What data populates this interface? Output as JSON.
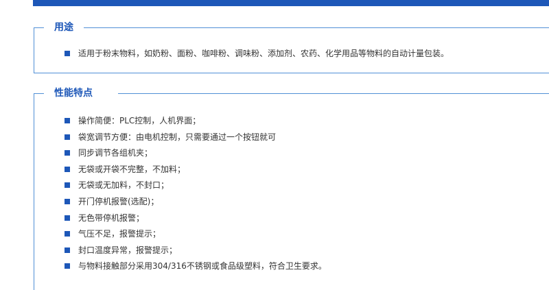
{
  "colors": {
    "accent": "#1d57b8",
    "border": "#4f8fd6",
    "text": "#333333"
  },
  "sections": [
    {
      "title": "用途",
      "items": [
        "适用于粉末物料，如奶粉、面粉、咖啡粉、调味粉、添加剂、农药、化学用品等物料的自动计量包装。"
      ]
    },
    {
      "title": "性能特点",
      "items": [
        "操作简便：PLC控制，人机界面；",
        "袋宽调节方便：由电机控制，只需要通过一个按钮就可",
        "同步调节各组机夹；",
        "无袋或开袋不完整，不加料；",
        "无袋或无加料，不封口；",
        "开门停机报警(选配)；",
        "无色带停机报警；",
        "气压不足，报警提示；",
        "封口温度异常，报警提示；",
        "与物料接触部分采用304/316不锈钢或食品级塑料，符合卫生要求。"
      ]
    }
  ]
}
